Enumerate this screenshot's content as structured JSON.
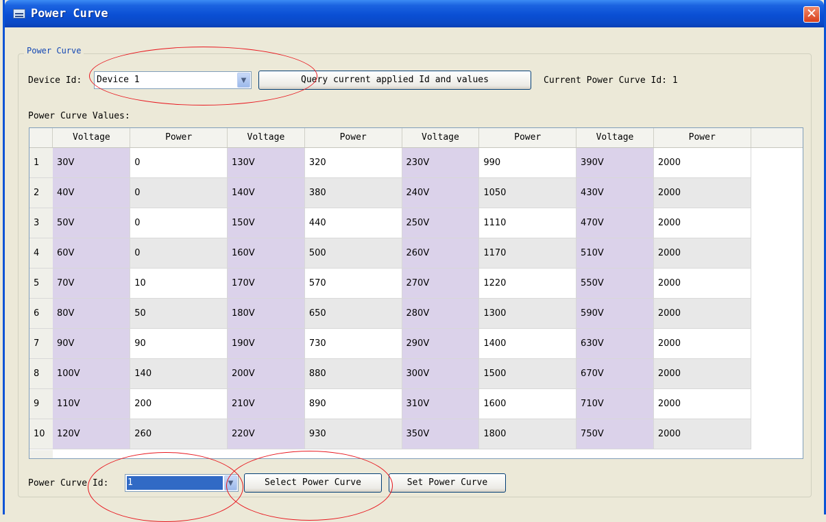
{
  "window": {
    "title": "Power Curve"
  },
  "group": {
    "label": "Power Curve"
  },
  "device": {
    "label": "Device Id:",
    "value": "Device 1",
    "query_button": "Query current applied Id and values",
    "current_label": "Current Power Curve Id: 1"
  },
  "values_label": "Power Curve Values:",
  "table": {
    "headers": [
      "Voltage",
      "Power",
      "Voltage",
      "Power",
      "Voltage",
      "Power",
      "Voltage",
      "Power"
    ],
    "rows": [
      [
        "1",
        "30V",
        "0",
        "130V",
        "320",
        "230V",
        "990",
        "390V",
        "2000"
      ],
      [
        "2",
        "40V",
        "0",
        "140V",
        "380",
        "240V",
        "1050",
        "430V",
        "2000"
      ],
      [
        "3",
        "50V",
        "0",
        "150V",
        "440",
        "250V",
        "1110",
        "470V",
        "2000"
      ],
      [
        "4",
        "60V",
        "0",
        "160V",
        "500",
        "260V",
        "1170",
        "510V",
        "2000"
      ],
      [
        "5",
        "70V",
        "10",
        "170V",
        "570",
        "270V",
        "1220",
        "550V",
        "2000"
      ],
      [
        "6",
        "80V",
        "50",
        "180V",
        "650",
        "280V",
        "1300",
        "590V",
        "2000"
      ],
      [
        "7",
        "90V",
        "90",
        "190V",
        "730",
        "290V",
        "1400",
        "630V",
        "2000"
      ],
      [
        "8",
        "100V",
        "140",
        "200V",
        "880",
        "300V",
        "1500",
        "670V",
        "2000"
      ],
      [
        "9",
        "110V",
        "200",
        "210V",
        "890",
        "310V",
        "1600",
        "710V",
        "2000"
      ],
      [
        "10",
        "120V",
        "260",
        "220V",
        "930",
        "350V",
        "1800",
        "750V",
        "2000"
      ]
    ]
  },
  "bottom": {
    "id_label": "Power Curve Id:",
    "id_value": "1",
    "select_button": "Select Power Curve",
    "set_button": "Set Power Curve"
  },
  "colors": {
    "voltage_cell": "#dbd2ea",
    "annotation": "#e8141c",
    "title_bar": "#0a4fd4"
  }
}
